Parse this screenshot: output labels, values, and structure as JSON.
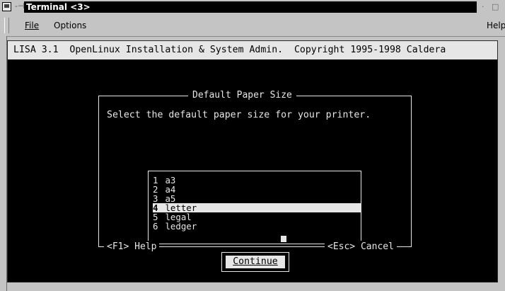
{
  "window": {
    "title": "Terminal <3>",
    "pin_glyph": "-⊣",
    "minimize_glyph": "·",
    "maximize_glyph": "□"
  },
  "menubar": {
    "file_label": "File",
    "options_label": "Options",
    "help_label": "Help"
  },
  "terminal": {
    "header_text": "LISA 3.1  OpenLinux Installation & System Admin.  Copyright 1995-1998 Caldera"
  },
  "dialog": {
    "title": "Default Paper Size",
    "prompt": "Select the default paper size for your printer.",
    "options": [
      {
        "num": "1",
        "label": "a3"
      },
      {
        "num": "2",
        "label": "a4"
      },
      {
        "num": "3",
        "label": "a5"
      },
      {
        "num": "4",
        "label": "letter"
      },
      {
        "num": "5",
        "label": "legal"
      },
      {
        "num": "6",
        "label": "ledger"
      }
    ],
    "selected_index": 3,
    "continue_label": "Continue",
    "help_hint": "<F1> Help",
    "cancel_hint": "<Esc> Cancel"
  },
  "colors": {
    "terminal_bg": "#000000",
    "terminal_fg": "#e6e6e6",
    "chrome": "#c4c4c4"
  }
}
